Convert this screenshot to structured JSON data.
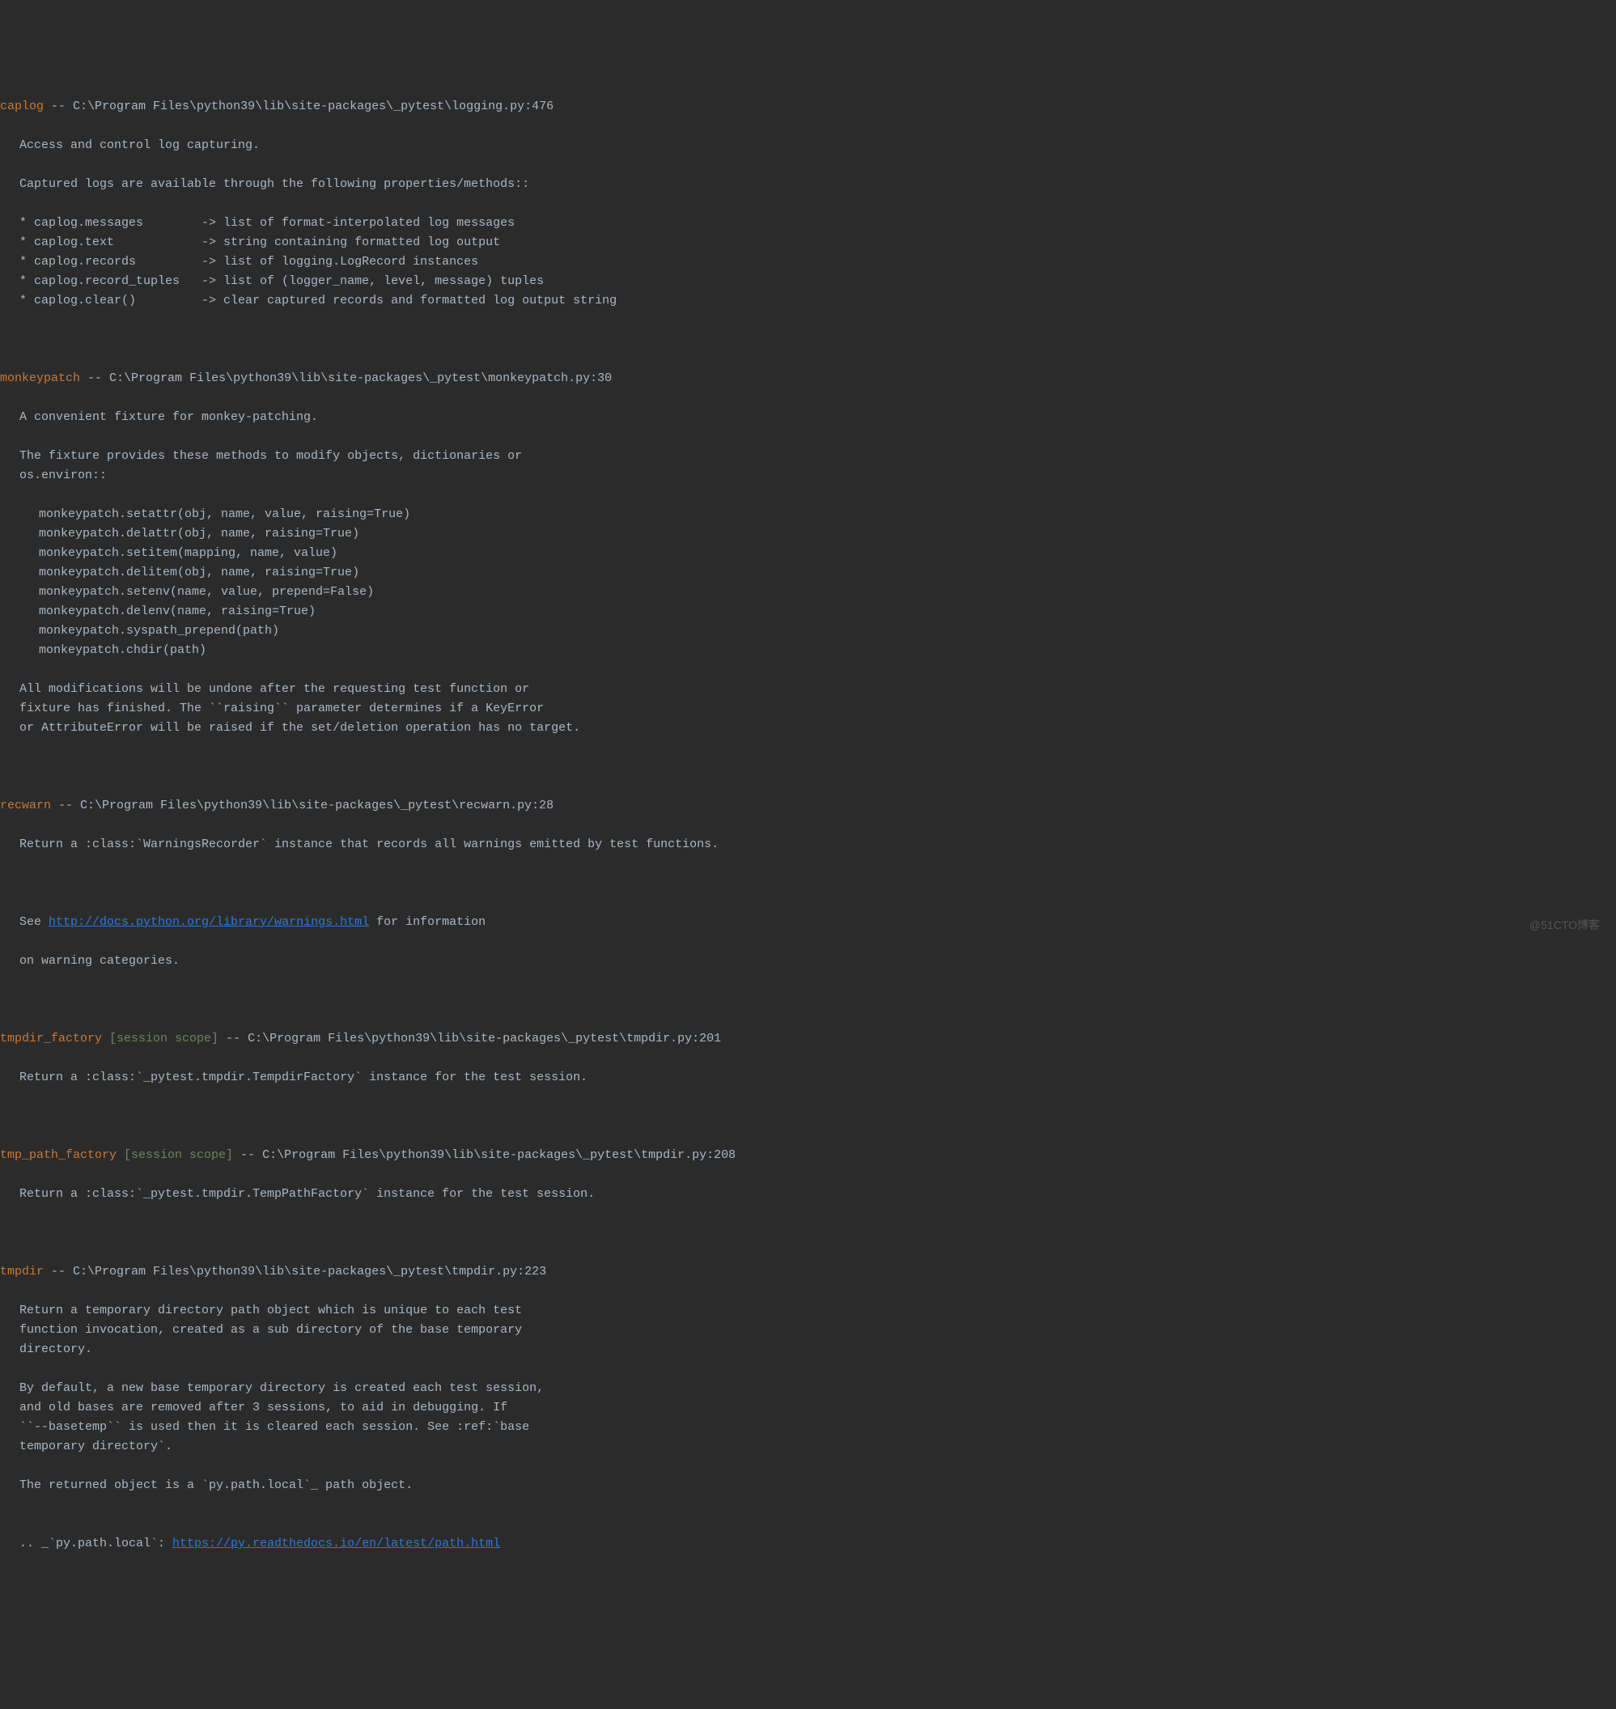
{
  "fixtures": {
    "caplog": {
      "name": "caplog",
      "sep": " -- ",
      "path": "C:\\Program Files\\python39\\lib\\site-packages\\_pytest\\logging.py:476",
      "lines": [
        {
          "text": "Access and control log capturing.",
          "indent": 1
        },
        {
          "text": "",
          "indent": 1
        },
        {
          "text": "Captured logs are available through the following properties/methods::",
          "indent": 1
        },
        {
          "text": "",
          "indent": 1
        },
        {
          "text": "* caplog.messages        -> list of format-interpolated log messages",
          "indent": 1
        },
        {
          "text": "* caplog.text            -> string containing formatted log output",
          "indent": 1
        },
        {
          "text": "* caplog.records         -> list of logging.LogRecord instances",
          "indent": 1
        },
        {
          "text": "* caplog.record_tuples   -> list of (logger_name, level, message) tuples",
          "indent": 1
        },
        {
          "text": "* caplog.clear()         -> clear captured records and formatted log output string",
          "indent": 1
        }
      ]
    },
    "monkeypatch": {
      "name": "monkeypatch",
      "sep": " -- ",
      "path": "C:\\Program Files\\python39\\lib\\site-packages\\_pytest\\monkeypatch.py:30",
      "lines": [
        {
          "text": "A convenient fixture for monkey-patching.",
          "indent": 1
        },
        {
          "text": "",
          "indent": 1
        },
        {
          "text": "The fixture provides these methods to modify objects, dictionaries or",
          "indent": 1
        },
        {
          "text": "os.environ::",
          "indent": 1
        },
        {
          "text": "",
          "indent": 1
        },
        {
          "text": "monkeypatch.setattr(obj, name, value, raising=True)",
          "indent": 2
        },
        {
          "text": "monkeypatch.delattr(obj, name, raising=True)",
          "indent": 2
        },
        {
          "text": "monkeypatch.setitem(mapping, name, value)",
          "indent": 2
        },
        {
          "text": "monkeypatch.delitem(obj, name, raising=True)",
          "indent": 2
        },
        {
          "text": "monkeypatch.setenv(name, value, prepend=False)",
          "indent": 2
        },
        {
          "text": "monkeypatch.delenv(name, raising=True)",
          "indent": 2
        },
        {
          "text": "monkeypatch.syspath_prepend(path)",
          "indent": 2
        },
        {
          "text": "monkeypatch.chdir(path)",
          "indent": 2
        },
        {
          "text": "",
          "indent": 1
        },
        {
          "text": "All modifications will be undone after the requesting test function or",
          "indent": 1
        },
        {
          "text": "fixture has finished. The ``raising`` parameter determines if a KeyError",
          "indent": 1
        },
        {
          "text": "or AttributeError will be raised if the set/deletion operation has no target.",
          "indent": 1
        }
      ]
    },
    "recwarn": {
      "name": "recwarn",
      "sep": " -- ",
      "path": "C:\\Program Files\\python39\\lib\\site-packages\\_pytest\\recwarn.py:28",
      "desc1": "Return a :class:`WarningsRecorder` instance that records all warnings emitted by test functions.",
      "see_prefix": "See ",
      "link": "http://docs.python.org/library/warnings.html",
      "see_suffix": " for information",
      "desc2": "on warning categories."
    },
    "tmpdir_factory": {
      "name": "tmpdir_factory",
      "scope": " [session scope]",
      "sep": " -- ",
      "path": "C:\\Program Files\\python39\\lib\\site-packages\\_pytest\\tmpdir.py:201",
      "desc": "Return a :class:`_pytest.tmpdir.TempdirFactory` instance for the test session."
    },
    "tmp_path_factory": {
      "name": "tmp_path_factory",
      "scope": " [session scope]",
      "sep": " -- ",
      "path": "C:\\Program Files\\python39\\lib\\site-packages\\_pytest\\tmpdir.py:208",
      "desc": "Return a :class:`_pytest.tmpdir.TempPathFactory` instance for the test session."
    },
    "tmpdir": {
      "name": "tmpdir",
      "sep": " -- ",
      "path": "C:\\Program Files\\python39\\lib\\site-packages\\_pytest\\tmpdir.py:223",
      "lines": [
        {
          "text": "Return a temporary directory path object which is unique to each test",
          "indent": 1
        },
        {
          "text": "function invocation, created as a sub directory of the base temporary",
          "indent": 1
        },
        {
          "text": "directory.",
          "indent": 1
        },
        {
          "text": "",
          "indent": 1
        },
        {
          "text": "By default, a new base temporary directory is created each test session,",
          "indent": 1
        },
        {
          "text": "and old bases are removed after 3 sessions, to aid in debugging. If",
          "indent": 1
        },
        {
          "text": "``--basetemp`` is used then it is cleared each session. See :ref:`base",
          "indent": 1
        },
        {
          "text": "temporary directory`.",
          "indent": 1
        },
        {
          "text": "",
          "indent": 1
        },
        {
          "text": "The returned object is a `py.path.local`_ path object.",
          "indent": 1
        },
        {
          "text": "",
          "indent": 1
        }
      ],
      "ref_prefix": ".. _`py.path.local`: ",
      "ref_link": "https://py.readthedocs.io/en/latest/path.html"
    }
  },
  "watermark": "@51CTO博客"
}
